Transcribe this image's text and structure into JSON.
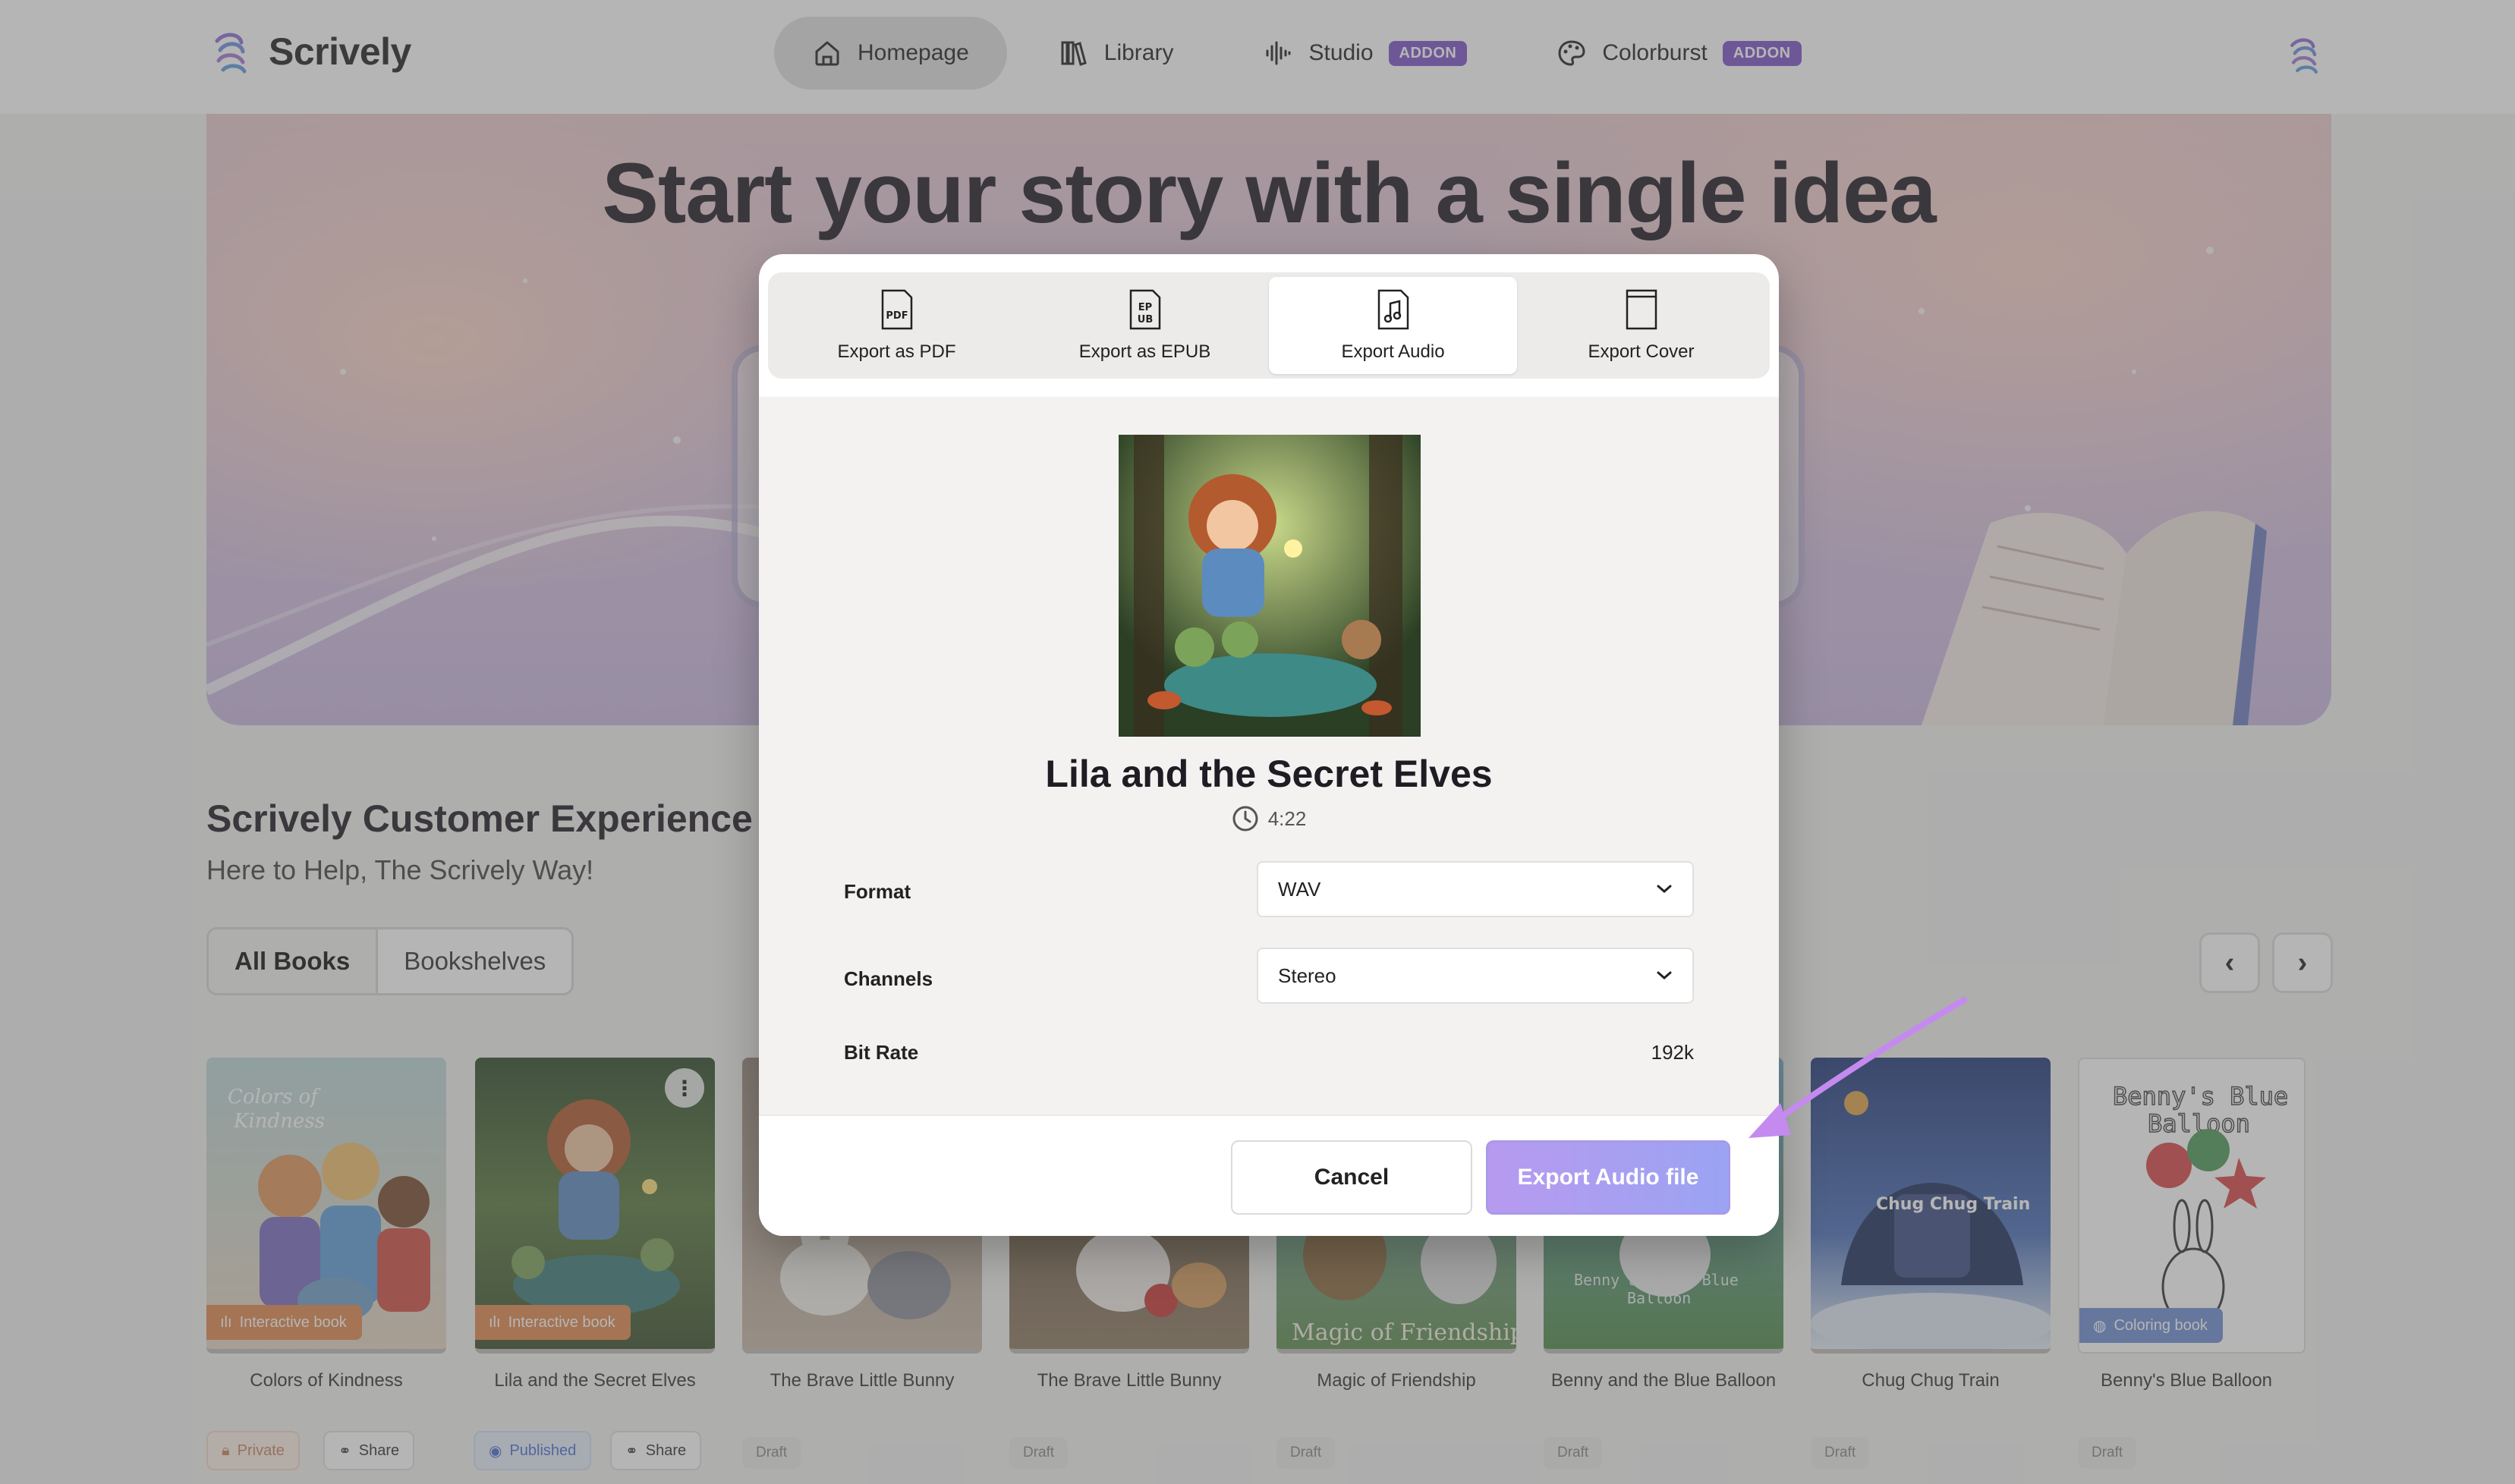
{
  "brand": {
    "name": "Scrively"
  },
  "nav": {
    "items": [
      {
        "label": "Homepage",
        "icon": "home-icon",
        "active": true
      },
      {
        "label": "Library",
        "icon": "library-icon"
      },
      {
        "label": "Studio",
        "icon": "audio-wave-icon",
        "badge": "ADDON"
      },
      {
        "label": "Colorburst",
        "icon": "palette-icon",
        "badge": "ADDON"
      }
    ]
  },
  "hero": {
    "title": "Start your story with a single idea"
  },
  "team": {
    "title": "Scrively Customer Experience Te",
    "subtitle": "Here to Help, The Scrively Way!"
  },
  "tabs": {
    "all_books": "All Books",
    "bookshelves": "Bookshelves"
  },
  "books": [
    {
      "title": "Colors of Kindness",
      "badge": "Interactive book",
      "cover_text": "Colors of Kindness",
      "chips": [
        "Private",
        "Share"
      ]
    },
    {
      "title": "Lila and the Secret Elves",
      "badge": "Interactive book",
      "chips": [
        "Published",
        "Share"
      ]
    },
    {
      "title": "The Brave Little Bunny",
      "chips": [
        "Draft"
      ]
    },
    {
      "title": "The Brave Little Bunny",
      "chips": [
        "Draft"
      ]
    },
    {
      "title": "Magic of Friendship",
      "cover_text": "Magic of Friendship",
      "chips": [
        "Draft"
      ]
    },
    {
      "title": "Benny and the Blue Balloon",
      "cover_text": "Benny and the Blue Balloon",
      "chips": [
        "Draft"
      ]
    },
    {
      "title": "Chug Chug Train",
      "cover_text": "Chug Chug Train",
      "chips": [
        "Draft"
      ]
    },
    {
      "title": "Benny's Blue Balloon",
      "badge": "Coloring book",
      "cover_text": "Benny's Blue Balloon",
      "chips": [
        "Draft"
      ]
    }
  ],
  "modal": {
    "tabs": [
      {
        "label": "Export as PDF",
        "icon": "pdf-file-icon"
      },
      {
        "label": "Export as EPUB",
        "icon": "epub-file-icon"
      },
      {
        "label": "Export Audio",
        "icon": "audio-file-icon",
        "active": true
      },
      {
        "label": "Export Cover",
        "icon": "cover-file-icon"
      }
    ],
    "book_title": "Lila and the Secret Elves",
    "duration": "4:22",
    "fields": {
      "format_label": "Format",
      "format_value": "WAV",
      "channels_label": "Channels",
      "channels_value": "Stereo",
      "bitrate_label": "Bit Rate",
      "bitrate_value": "192k"
    },
    "cancel": "Cancel",
    "export": "Export Audio file"
  },
  "colors": {
    "accent": "#7d54c9",
    "export_start": "#b79af0",
    "export_end": "#9ba3f2",
    "annotation": "#c58af0"
  }
}
